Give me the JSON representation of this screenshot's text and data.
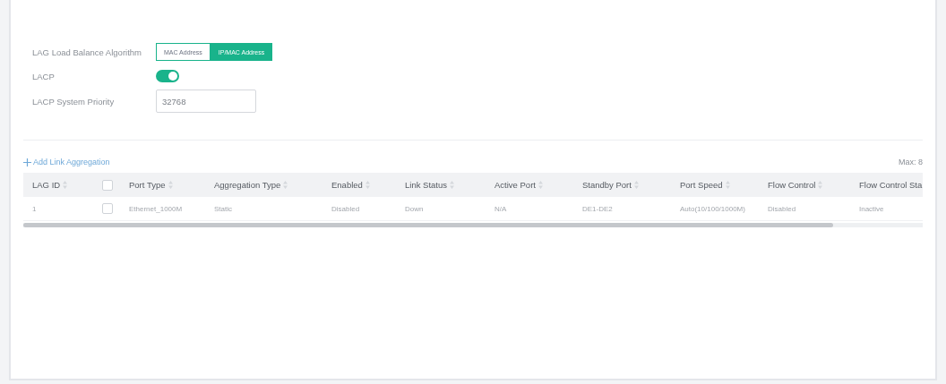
{
  "settings": {
    "algorithm": {
      "label": "LAG Load Balance Algorithm",
      "options": [
        {
          "label": "MAC Address",
          "selected": false
        },
        {
          "label": "IP/MAC Address",
          "selected": true
        }
      ]
    },
    "lacp": {
      "label": "LACP",
      "on": true
    },
    "priority": {
      "label": "LACP System Priority",
      "value": "32768"
    }
  },
  "table": {
    "add_label": "Add Link Aggregation",
    "max": "Max: 8",
    "columns": [
      "LAG ID",
      "",
      "Port Type",
      "Aggregation Type",
      "Enabled",
      "Link Status",
      "Active Port",
      "Standby Port",
      "Port Speed",
      "Flow Control",
      "Flow Control Sta"
    ],
    "select_all_checked": false,
    "rows": [
      {
        "checked": false,
        "cells": [
          "1",
          "",
          "Ethernet_1000M",
          "Static",
          "Disabled",
          "Down",
          "N/A",
          "DE1-DE2",
          "Auto(10/100/1000M)",
          "Disabled",
          "Inactive"
        ]
      }
    ]
  }
}
